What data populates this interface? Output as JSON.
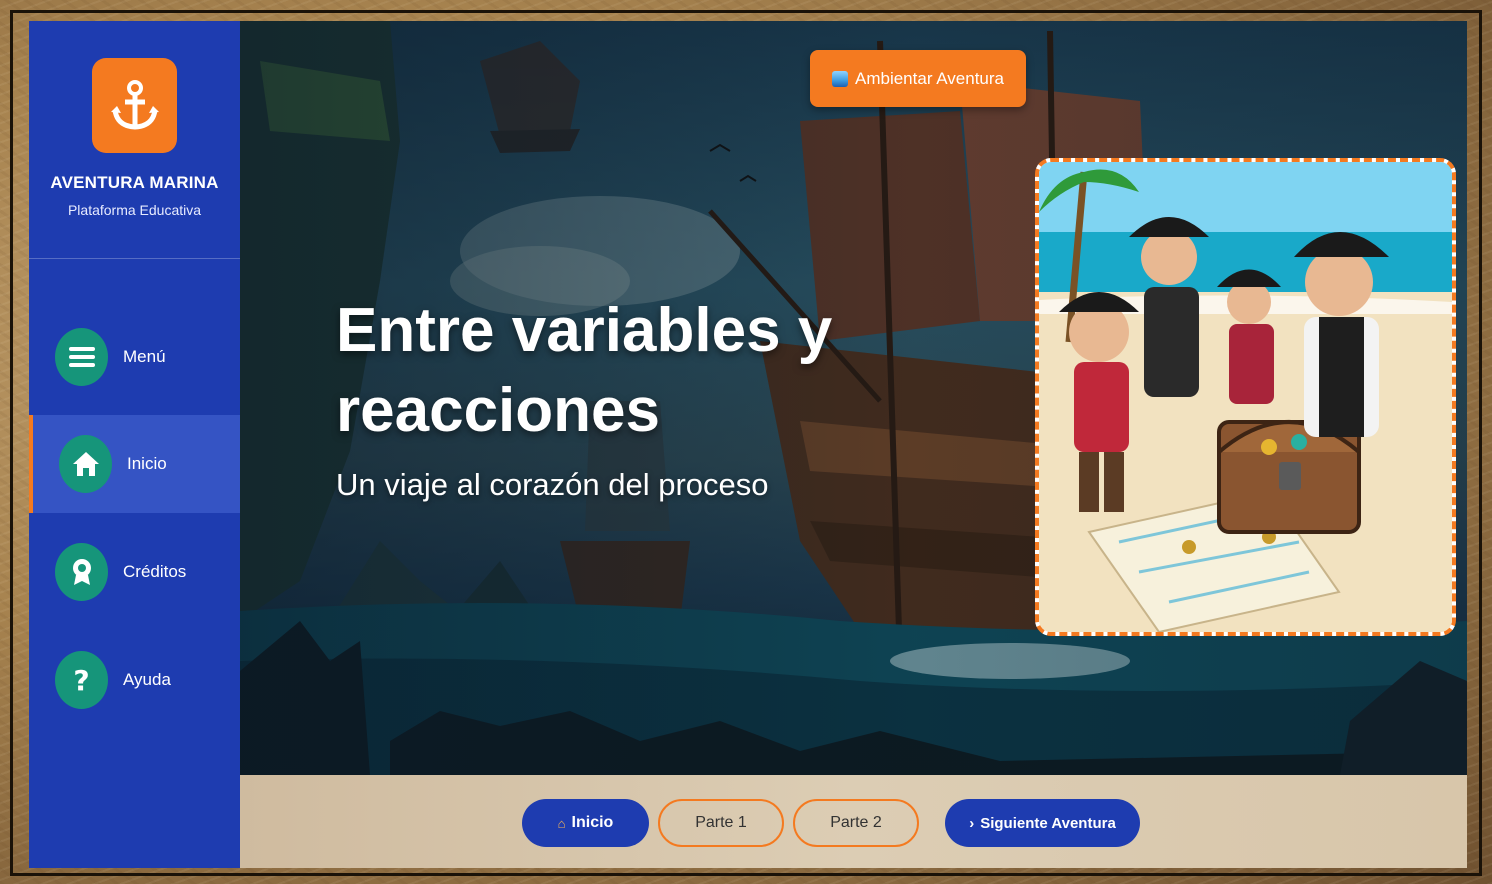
{
  "sidebar": {
    "brand_title": "AVENTURA MARINA",
    "brand_subtitle": "Plataforma Educativa",
    "logo_icon": "anchor-icon",
    "items": [
      {
        "label": "Menú",
        "icon": "menu-icon"
      },
      {
        "label": "Inicio",
        "icon": "home-icon",
        "active": true
      },
      {
        "label": "Créditos",
        "icon": "award-icon"
      },
      {
        "label": "Ayuda",
        "icon": "help-icon"
      }
    ]
  },
  "hero": {
    "title": "Entre variables y reacciones",
    "subtitle": "Un viaje al corazón del proceso",
    "ambient_button": "Ambientar Aventura",
    "ambient_icon": "wave-icon"
  },
  "bottom_nav": {
    "home": "Inicio",
    "part1": "Parte 1",
    "part2": "Parte 2",
    "next": "Siguiente Aventura"
  },
  "colors": {
    "sidebar": "#1e3cb0",
    "accent": "#f47a20",
    "icon_bg": "#16957a"
  }
}
